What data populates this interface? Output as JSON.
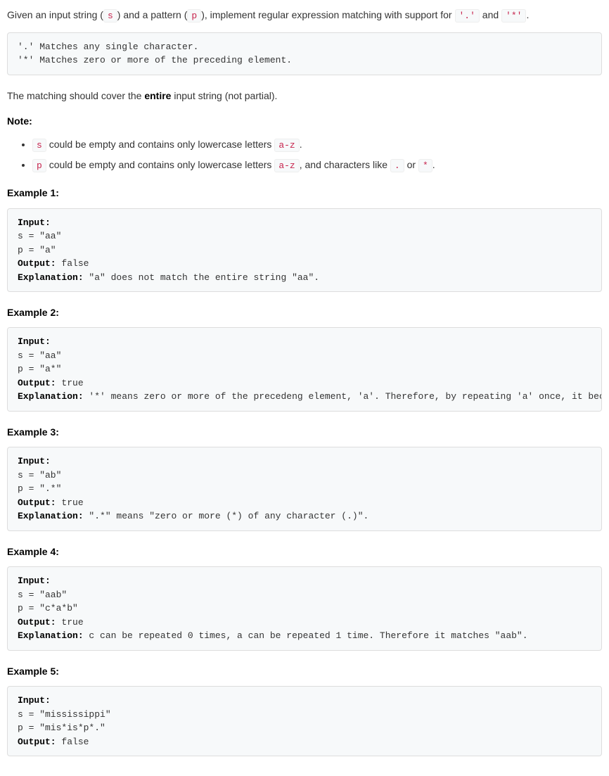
{
  "intro": {
    "part1": "Given an input string (",
    "s": "s",
    "part2": ") and a pattern (",
    "p": "p",
    "part3": "), implement regular expression matching with support for ",
    "dot": "'.'",
    "and": " and ",
    "star": "'*'",
    "end": "."
  },
  "spec_block": "'.' Matches any single character.\n'*' Matches zero or more of the preceding element.",
  "coverage": {
    "part1": "The matching should cover the ",
    "entire": "entire",
    "part2": " input string (not partial)."
  },
  "note_heading": "Note:",
  "notes": {
    "item1": {
      "code1": "s",
      "text1": " could be empty and contains only lowercase letters ",
      "code2": "a-z",
      "text2": "."
    },
    "item2": {
      "code1": "p",
      "text1": " could be empty and contains only lowercase letters ",
      "code2": "a-z",
      "text2": ", and characters like ",
      "code3": ".",
      "text3": " or ",
      "code4": "*",
      "text4": "."
    }
  },
  "examples": [
    {
      "heading": "Example 1:",
      "labels": {
        "input": "Input:",
        "output": "Output:",
        "expl": "Explanation:"
      },
      "body": "\ns = \"aa\"\np = \"a\"\n",
      "output": " false\n",
      "expl": " \"a\" does not match the entire string \"aa\"."
    },
    {
      "heading": "Example 2:",
      "labels": {
        "input": "Input:",
        "output": "Output:",
        "expl": "Explanation:"
      },
      "body": "\ns = \"aa\"\np = \"a*\"\n",
      "output": " true\n",
      "expl": " '*' means zero or more of the precedeng element, 'a'. Therefore, by repeating 'a' once, it becomes \"aa\"."
    },
    {
      "heading": "Example 3:",
      "labels": {
        "input": "Input:",
        "output": "Output:",
        "expl": "Explanation:"
      },
      "body": "\ns = \"ab\"\np = \".*\"\n",
      "output": " true\n",
      "expl": " \".*\" means \"zero or more (*) of any character (.)\"."
    },
    {
      "heading": "Example 4:",
      "labels": {
        "input": "Input:",
        "output": "Output:",
        "expl": "Explanation:"
      },
      "body": "\ns = \"aab\"\np = \"c*a*b\"\n",
      "output": " true\n",
      "expl": " c can be repeated 0 times, a can be repeated 1 time. Therefore it matches \"aab\"."
    },
    {
      "heading": "Example 5:",
      "labels": {
        "input": "Input:",
        "output": "Output:"
      },
      "body": "\ns = \"mississippi\"\np = \"mis*is*p*.\"\n",
      "output": " false"
    }
  ]
}
